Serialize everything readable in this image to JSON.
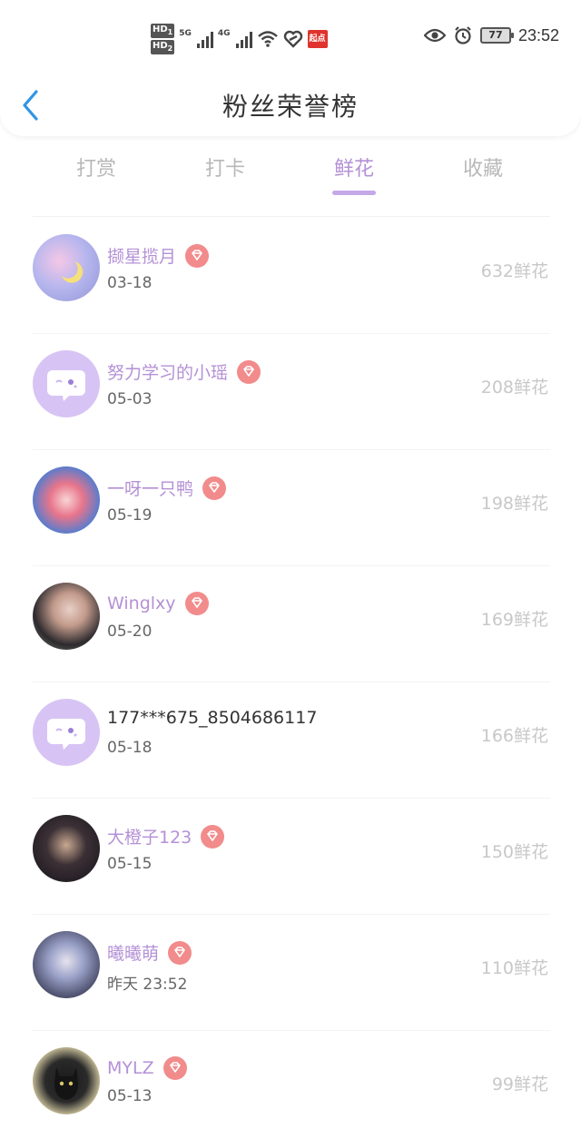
{
  "status_bar": {
    "hd1": "HD",
    "hd1_sub": "1",
    "hd2": "HD",
    "hd2_sub": "2",
    "net1": "5G",
    "net2": "4G",
    "app_badge": "起点",
    "battery": "77",
    "time": "23:52"
  },
  "header": {
    "title": "粉丝荣誉榜"
  },
  "tabs": [
    {
      "label": "打赏",
      "active": false
    },
    {
      "label": "打卡",
      "active": false
    },
    {
      "label": "鲜花",
      "active": true
    },
    {
      "label": "收藏",
      "active": false
    }
  ],
  "colors": {
    "accent": "#b491d6",
    "indicator": "#c5a8e6",
    "gem": "#f28b8b",
    "back_arrow": "#2f95e6"
  },
  "rows": [
    {
      "name": "撷星揽月",
      "date": "03-18",
      "count": "632鲜花",
      "badge": "diamond-icon"
    },
    {
      "name": "努力学习的小瑶",
      "date": "05-03",
      "count": "208鲜花",
      "badge": "diamond-icon"
    },
    {
      "name": "一呀一只鸭",
      "date": "05-19",
      "count": "198鲜花",
      "badge": "diamond-icon"
    },
    {
      "name": "Winglxy",
      "date": "05-20",
      "count": "169鲜花",
      "badge": "diamond-icon"
    },
    {
      "name": "177***675_8504686117",
      "date": "05-18",
      "count": "166鲜花",
      "badge": ""
    },
    {
      "name": "大橙子123",
      "date": "05-15",
      "count": "150鲜花",
      "badge": "diamond-icon"
    },
    {
      "name": "曦曦萌",
      "date": "昨天 23:52",
      "count": "110鲜花",
      "badge": "diamond-icon"
    },
    {
      "name": "MYLZ",
      "date": "05-13",
      "count": "99鲜花",
      "badge": "diamond-icon"
    }
  ]
}
